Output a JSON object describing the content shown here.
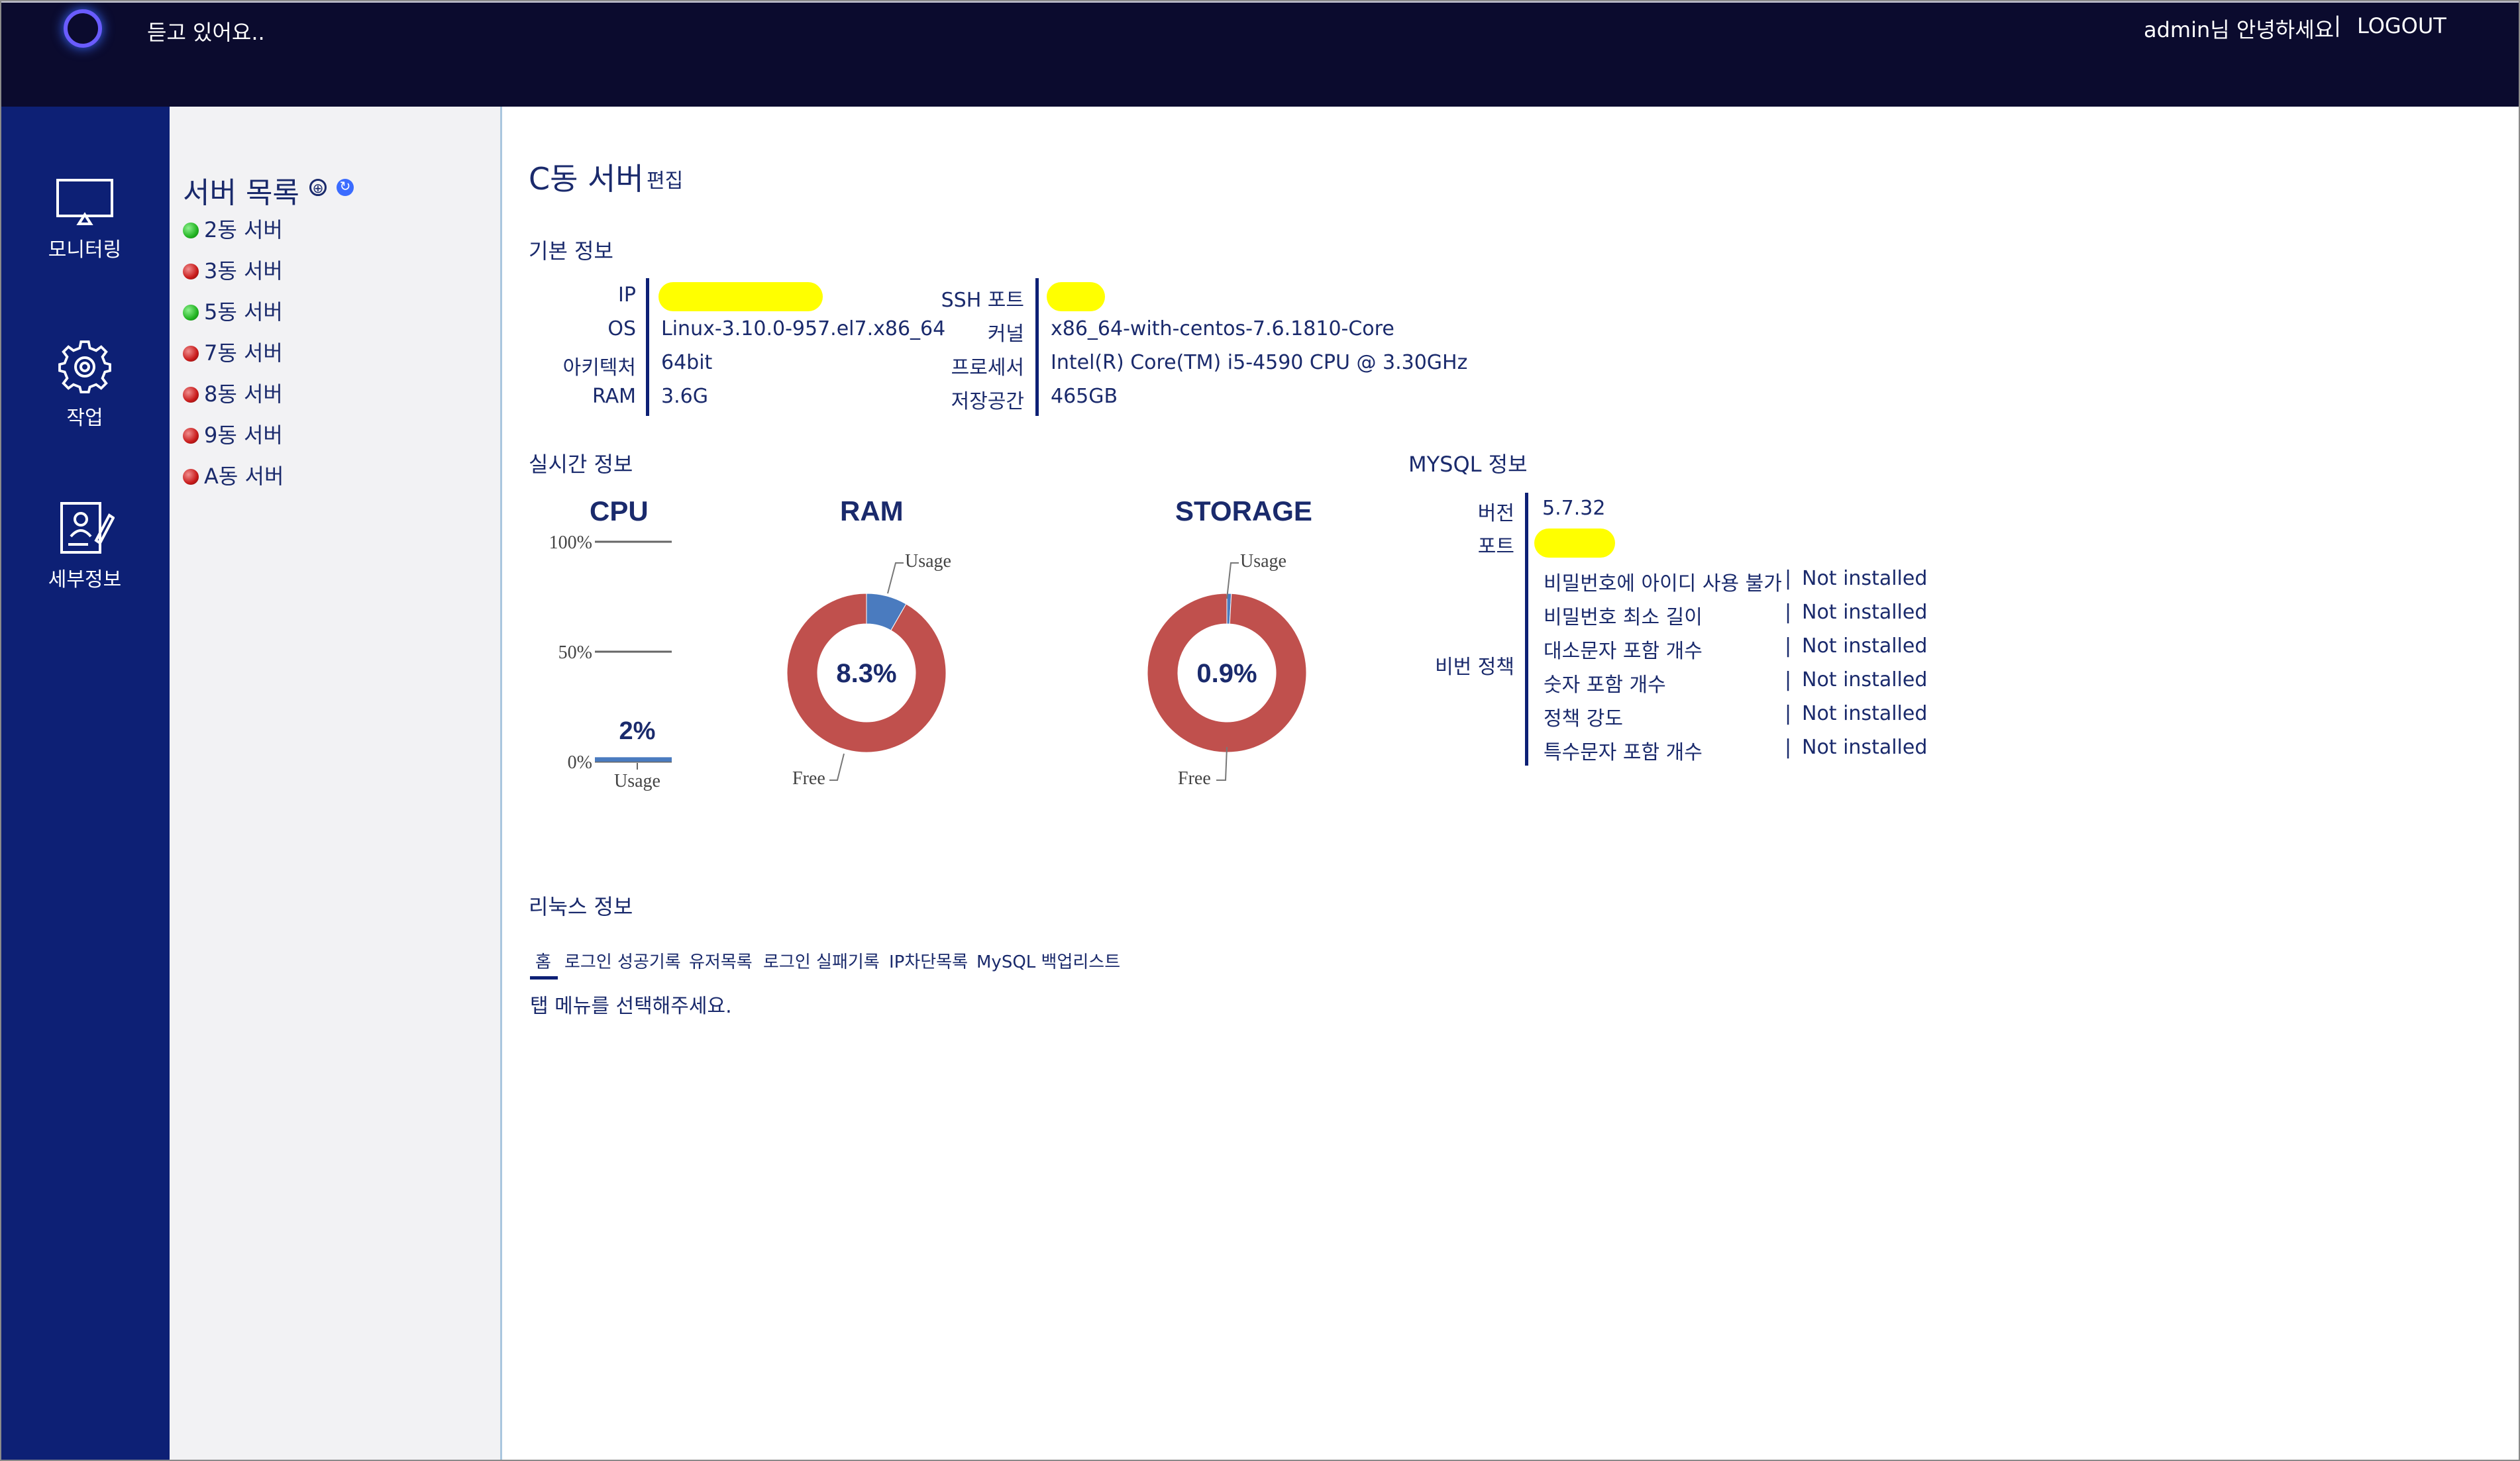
{
  "header": {
    "status_text": "듣고 있어요..",
    "greeting": "admin님 안녕하세요",
    "separator": "|",
    "logout": "LOGOUT"
  },
  "nav": {
    "items": [
      {
        "label": "모니터링",
        "icon": "monitor-icon"
      },
      {
        "label": "작업",
        "icon": "gear-icon"
      },
      {
        "label": "세부정보",
        "icon": "profile-document-icon"
      }
    ]
  },
  "server_list": {
    "title": "서버 목록",
    "add_icon": "⊕",
    "refresh_icon": "↻",
    "servers": [
      {
        "name": "2동 서버",
        "status": "online"
      },
      {
        "name": "3동 서버",
        "status": "offline"
      },
      {
        "name": "5동 서버",
        "status": "online"
      },
      {
        "name": "7동 서버",
        "status": "offline"
      },
      {
        "name": "8동 서버",
        "status": "offline"
      },
      {
        "name": "9동 서버",
        "status": "offline"
      },
      {
        "name": "A동 서버",
        "status": "offline"
      }
    ],
    "status_colors": {
      "online": "#22b422",
      "offline": "#c81a1a"
    }
  },
  "main": {
    "server_title": "C동 서버",
    "edit_label": "편집",
    "basic_info": {
      "heading": "기본 정보",
      "left": [
        {
          "label": "IP",
          "value": ""
        },
        {
          "label": "OS",
          "value": "Linux-3.10.0-957.el7.x86_64"
        },
        {
          "label": "아키텍처",
          "value": "64bit"
        },
        {
          "label": "RAM",
          "value": "3.6G"
        }
      ],
      "right": [
        {
          "label": "SSH 포트",
          "value": ""
        },
        {
          "label": "커널",
          "value": "x86_64-with-centos-7.6.1810-Core"
        },
        {
          "label": "프로세서",
          "value": "Intel(R) Core(TM) i5-4590 CPU @ 3.30GHz"
        },
        {
          "label": "저장공간",
          "value": "465GB"
        }
      ]
    },
    "realtime": {
      "heading": "실시간 정보"
    },
    "mysql": {
      "heading": "MYSQL 정보",
      "version_label": "버전",
      "version_value": "5.7.32",
      "port_label": "포트",
      "policy_label": "비번 정책",
      "policies": [
        {
          "name": "비밀번호에 아이디 사용 불가",
          "value": "Not installed"
        },
        {
          "name": "비밀번호 최소 길이",
          "value": "Not installed"
        },
        {
          "name": "대소문자 포함 개수",
          "value": "Not installed"
        },
        {
          "name": "숫자 포함 개수",
          "value": "Not installed"
        },
        {
          "name": "정책 강도",
          "value": "Not installed"
        },
        {
          "name": "특수문자 포함 개수",
          "value": "Not installed"
        }
      ],
      "policy_separator": "|"
    },
    "linux": {
      "heading": "리눅스 정보",
      "tabs": [
        "홈",
        "로그인 성공기록",
        "유저목록",
        "로그인 실패기록",
        "IP차단목록",
        "MySQL 백업리스트"
      ],
      "active_tab": 0,
      "message": "탭 메뉴를 선택해주세요."
    }
  },
  "chart_data": [
    {
      "type": "bar",
      "title": "CPU",
      "categories": [
        "Usage"
      ],
      "values": [
        2
      ],
      "value_label": "2%",
      "ylim": [
        0,
        100
      ],
      "ytick_labels": [
        "100%",
        "50%",
        "0%"
      ],
      "xlabel": "Usage",
      "colors": {
        "bar": "#4a7bbf",
        "ref_lines": "#666666"
      }
    },
    {
      "type": "pie",
      "title": "RAM",
      "labels": [
        "Usage",
        "Free"
      ],
      "values": [
        8.3,
        91.7
      ],
      "center_label": "8.3%",
      "colors": [
        "#4a7bbf",
        "#c0504d"
      ]
    },
    {
      "type": "pie",
      "title": "STORAGE",
      "labels": [
        "Usage",
        "Free"
      ],
      "values": [
        0.9,
        99.1
      ],
      "center_label": "0.9%",
      "colors": [
        "#4a7bbf",
        "#c0504d"
      ]
    }
  ]
}
